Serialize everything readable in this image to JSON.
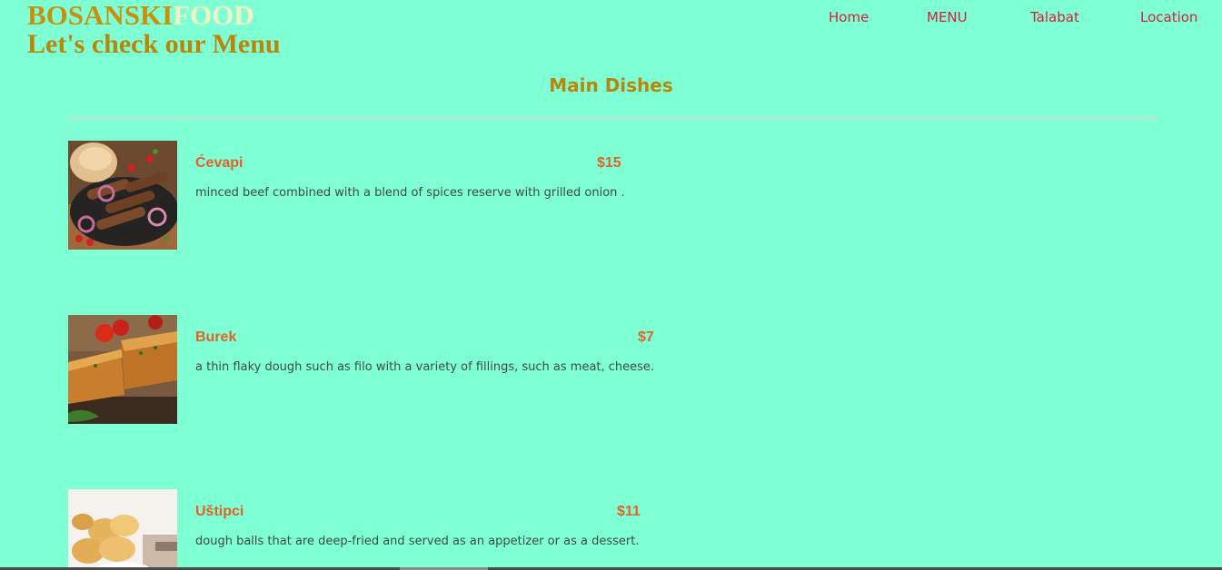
{
  "header": {
    "brand_part1": "BOSANSKI",
    "brand_part2": "FOOD",
    "tagline": "Let's check our Menu"
  },
  "nav": {
    "items": [
      "Home",
      "MENU",
      "Talabat",
      "Location"
    ]
  },
  "section": {
    "title": "Main Dishes"
  },
  "dishes": [
    {
      "name": "Ćevapi",
      "price": "$15",
      "description": "minced beef combined with a blend of spices reserve with grilled onion ."
    },
    {
      "name": "Burek",
      "price": "$7",
      "description": "a thin flaky dough such as filo with a variety of fillings, such as meat, cheese."
    },
    {
      "name": "Uštipci",
      "price": "$11",
      "description": "dough balls that are deep-fried and served as an appetizer or as a dessert."
    }
  ],
  "colors": {
    "background": "#7fffd4",
    "brand_gold": "#c8900f",
    "brand_cream": "#f3f0c4",
    "nav_red": "#d0203f",
    "title_gold": "#b8860b",
    "dish_orange": "#e0622a"
  }
}
